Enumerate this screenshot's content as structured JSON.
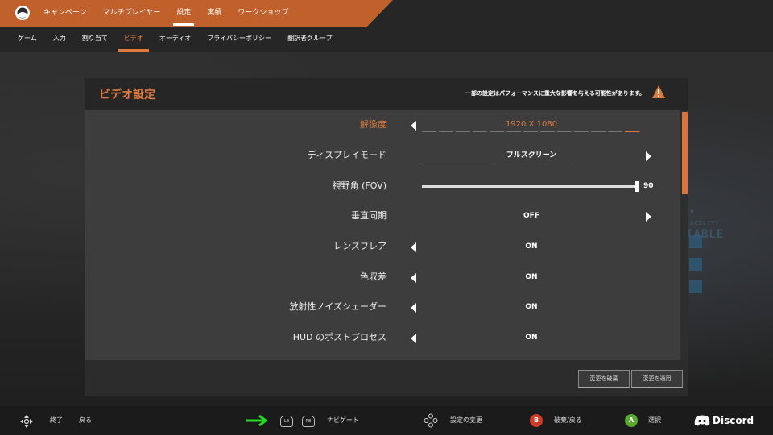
{
  "nav": {
    "items": [
      "キャンペーン",
      "マルチプレイヤー",
      "設定",
      "実績",
      "ワークショップ"
    ],
    "active": 2
  },
  "subnav": {
    "items": [
      "ゲーム",
      "入力",
      "割り当て",
      "ビデオ",
      "オーディオ",
      "プライバシーポリシー",
      "翻訳者グループ"
    ],
    "active": 3
  },
  "panel": {
    "title": "ビデオ設定",
    "warning": "一部の設定はパフォーマンスに重大な影響を与える可能性があります。",
    "settings": [
      {
        "label": "解像度",
        "value": "1920 X 1080"
      },
      {
        "label": "ディスプレイモード",
        "value": "フルスクリーン"
      },
      {
        "label": "視野角 (FOV)",
        "value": "90",
        "level": 1.0
      },
      {
        "label": "垂直同期",
        "value": "OFF"
      },
      {
        "label": "レンズフレア",
        "value": "ON"
      },
      {
        "label": "色収差",
        "value": "ON"
      },
      {
        "label": "放射性ノイズシェーダー",
        "value": "ON"
      },
      {
        "label": "HUD のポストプロセス",
        "value": "ON"
      }
    ],
    "discard_label": "変更を破棄",
    "apply_label": "変更を適用"
  },
  "bottombar": {
    "exit": "終了",
    "back": "戻る",
    "navigate": "ナビゲート",
    "lb": "LB",
    "rb": "RB",
    "change": "設定の変更",
    "b_button": "B",
    "discard_back": "破棄/戻る",
    "a_button": "A",
    "select": "選択",
    "discord": "Discord"
  },
  "colors": {
    "accent": "#e07a3a",
    "b_button": "#d23a2a",
    "a_button": "#5aa832",
    "arrow": "#22dd22"
  }
}
